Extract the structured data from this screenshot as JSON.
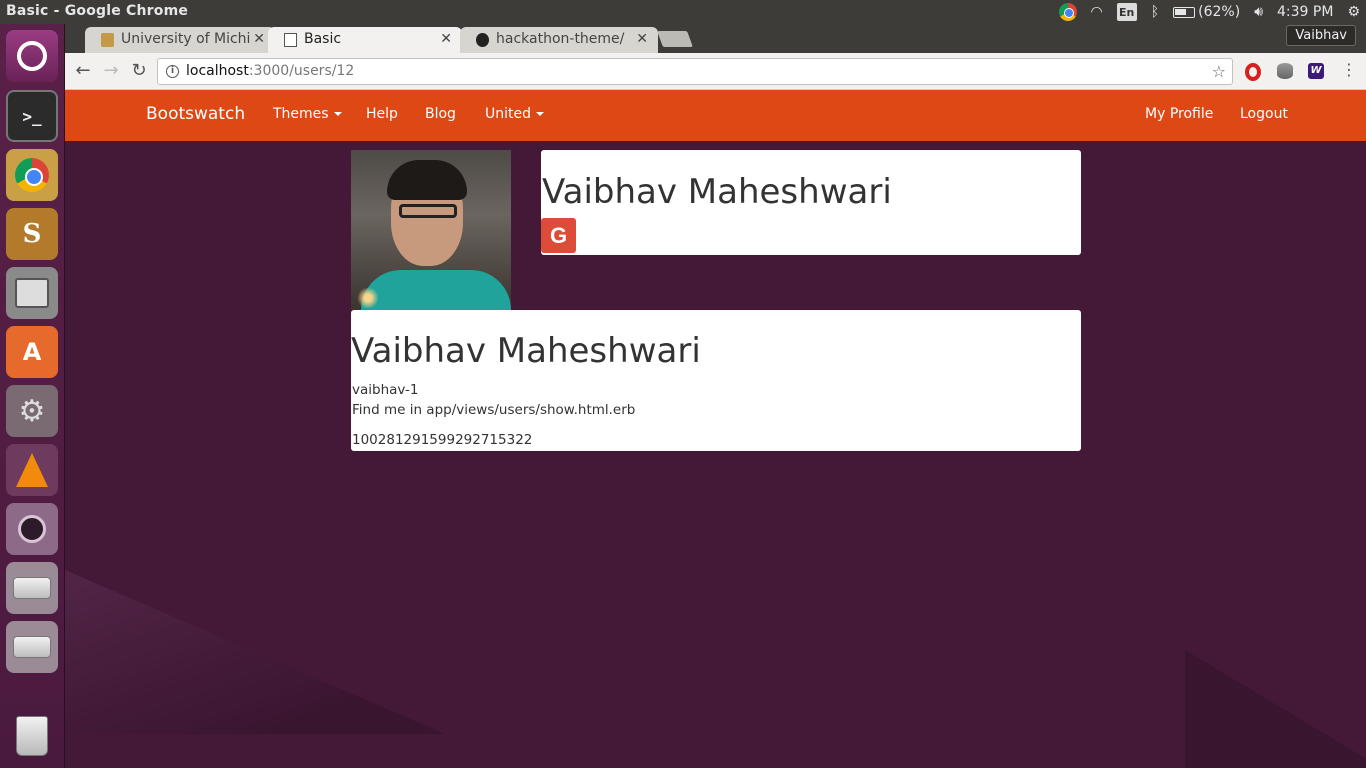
{
  "window": {
    "title": "Basic - Google Chrome"
  },
  "tray": {
    "lang": "En",
    "battery": "(62%)",
    "clock": "4:39 PM"
  },
  "tabs": [
    {
      "label": "University of Michi",
      "active": false
    },
    {
      "label": "Basic",
      "active": true
    },
    {
      "label": "hackathon-theme/",
      "active": false
    }
  ],
  "profile_chip": "Vaibhav",
  "address": {
    "host": "localhost",
    "path": ":3000/users/12"
  },
  "navbar": {
    "brand": "Bootswatch",
    "links": [
      "Themes",
      "Help",
      "Blog",
      "United"
    ],
    "right_links": [
      "My Profile",
      "Logout"
    ],
    "color": "#dd4814"
  },
  "profile": {
    "name": "Vaibhav Maheshwari",
    "provider_icon": "google-icon",
    "provider_letter": "G",
    "username": "vaibhav-1",
    "note": "Find me in app/views/users/show.html.erb",
    "uid": "100281291599292715322"
  },
  "colors": {
    "background": "#441937",
    "google": "#dd4b39"
  }
}
